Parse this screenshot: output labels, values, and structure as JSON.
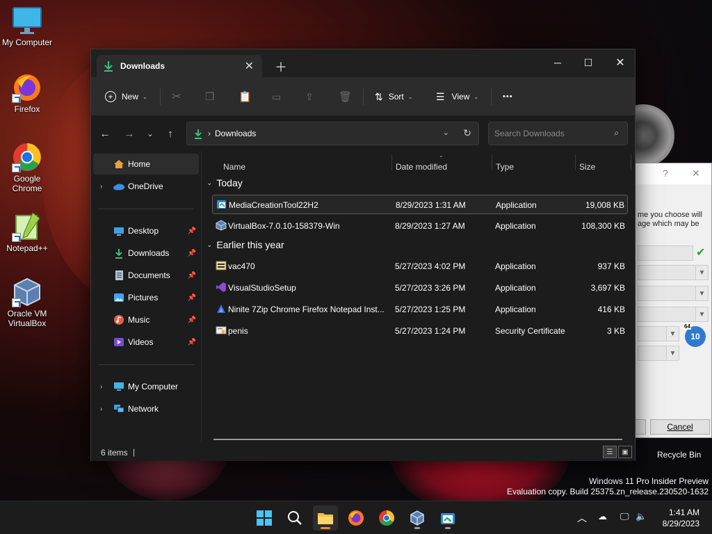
{
  "desktop": {
    "icons": [
      {
        "label": "My Computer"
      },
      {
        "label": "Firefox"
      },
      {
        "label": "Google Chrome"
      },
      {
        "label": "Notepad++"
      },
      {
        "label": "Oracle VM VirtualBox"
      }
    ],
    "recycle_bin": "Recycle Bin",
    "watermark_line1": "Windows 11 Pro Insider Preview",
    "watermark_line2": "Evaluation copy. Build 25375.zn_release.230520-1632"
  },
  "dialog": {
    "question": "?",
    "close": "✕",
    "text_line1": "me you choose will",
    "text_line2": "age which may be",
    "cancel_label": "Cancel",
    "badge_top": "64",
    "badge_num": "10"
  },
  "explorer": {
    "tab_title": "Downloads",
    "toolbar": {
      "new_label": "New",
      "sort_label": "Sort",
      "view_label": "View",
      "more_label": "•••"
    },
    "address": {
      "crumb": "Downloads",
      "sep": "›"
    },
    "search": {
      "placeholder": "Search Downloads"
    },
    "sidebar": {
      "home": "Home",
      "onedrive": "OneDrive",
      "pinned": [
        {
          "label": "Desktop"
        },
        {
          "label": "Downloads"
        },
        {
          "label": "Documents"
        },
        {
          "label": "Pictures"
        },
        {
          "label": "Music"
        },
        {
          "label": "Videos"
        }
      ],
      "my_computer": "My Computer",
      "network": "Network"
    },
    "columns": {
      "name": "Name",
      "date": "Date modified",
      "type": "Type",
      "size": "Size"
    },
    "groups": [
      {
        "label": "Today",
        "files": [
          {
            "name": "MediaCreationTool22H2",
            "date": "8/29/2023 1:31 AM",
            "type": "Application",
            "size": "19,008 KB"
          },
          {
            "name": "VirtualBox-7.0.10-158379-Win",
            "date": "8/29/2023 1:27 AM",
            "type": "Application",
            "size": "108,300 KB"
          }
        ]
      },
      {
        "label": "Earlier this year",
        "files": [
          {
            "name": "vac470",
            "date": "5/27/2023 4:02 PM",
            "type": "Application",
            "size": "937 KB"
          },
          {
            "name": "VisualStudioSetup",
            "date": "5/27/2023 3:26 PM",
            "type": "Application",
            "size": "3,697 KB"
          },
          {
            "name": "Ninite 7Zip Chrome Firefox Notepad Inst...",
            "date": "5/27/2023 1:25 PM",
            "type": "Application",
            "size": "416 KB"
          },
          {
            "name": "penis",
            "date": "5/27/2023 1:24 PM",
            "type": "Security Certificate",
            "size": "3 KB"
          }
        ]
      }
    ],
    "status": {
      "count": "6 items"
    }
  },
  "taskbar": {
    "clock_time": "1:41 AM",
    "clock_date": "8/29/2023"
  },
  "colors": {
    "accent_download": "#3fbf7f",
    "folder_yellow": "#f2c14e",
    "onedrive_blue": "#3a8ee6",
    "taskbar_active": "#f08a24"
  }
}
